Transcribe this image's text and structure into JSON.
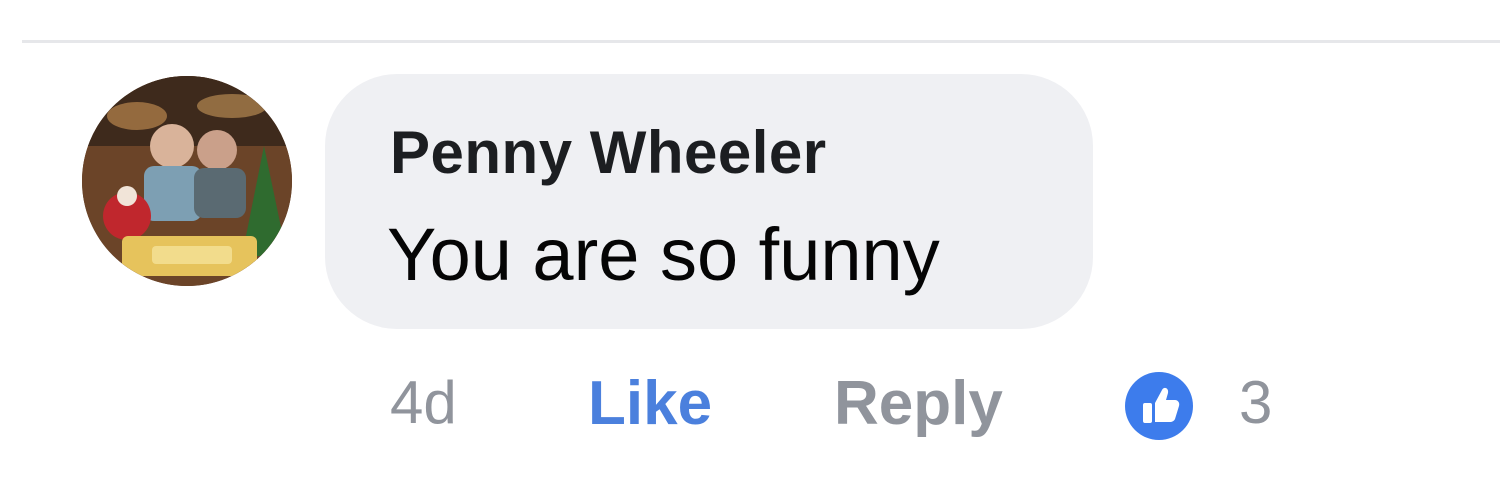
{
  "comment": {
    "author": "Penny Wheeler",
    "text": "You are so funny",
    "avatar_icon": "profile-photo-icon"
  },
  "actions": {
    "time": "4d",
    "like_label": "Like",
    "reply_label": "Reply",
    "reaction_icon": "thumbs-up-icon",
    "reaction_count": "3"
  },
  "colors": {
    "like_blue": "#4b80dd",
    "badge_blue": "#3d7cec",
    "bubble_bg": "#eff0f3",
    "muted_text": "#90949c"
  }
}
